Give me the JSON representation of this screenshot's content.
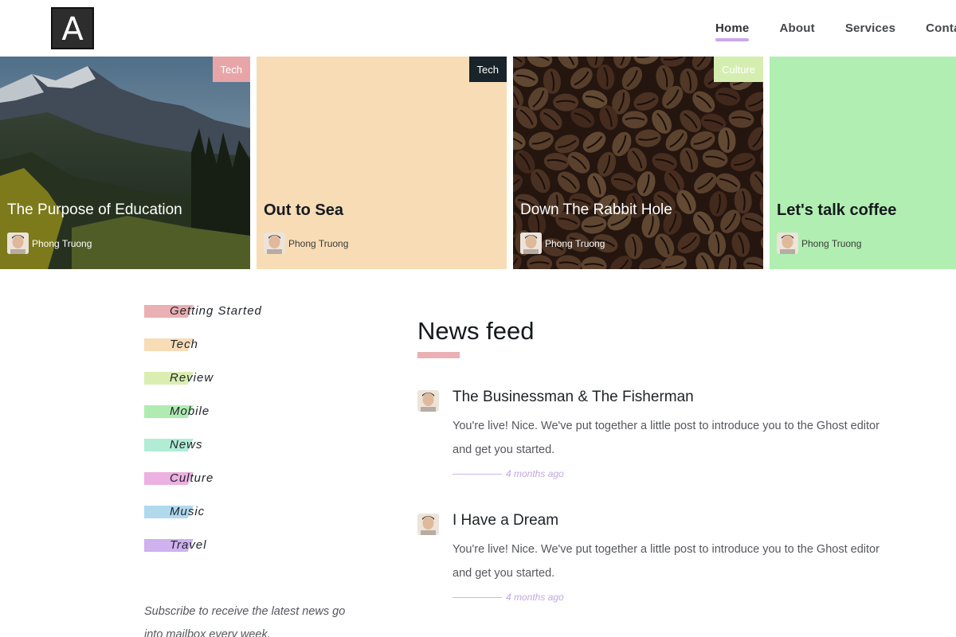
{
  "logo": {
    "letter": "A"
  },
  "nav": [
    {
      "label": "Home",
      "active": true
    },
    {
      "label": "About",
      "active": false
    },
    {
      "label": "Services",
      "active": false
    },
    {
      "label": "Conta",
      "active": false
    }
  ],
  "featured": [
    {
      "title": "The Purpose of Education",
      "tag": "Tech",
      "tag_color": "#e8a5a8",
      "author": "Phong Truong",
      "background": "mountain-photo"
    },
    {
      "title": "Out to Sea",
      "tag": "Tech",
      "tag_color": "#18242a",
      "author": "Phong Truong",
      "background": "#f7dcb5"
    },
    {
      "title": "Down The Rabbit Hole",
      "tag": "Culture",
      "tag_color": "#d4eeb0",
      "author": "Phong Truong",
      "background": "coffee-beans-photo"
    },
    {
      "title": "Let's talk coffee",
      "tag": "",
      "tag_color": "",
      "author": "Phong Truong",
      "background": "#b1eeb1"
    }
  ],
  "categories": [
    {
      "label": "Getting Started",
      "color": "#eab0b3"
    },
    {
      "label": "Tech",
      "color": "#f8dcb6"
    },
    {
      "label": "Review",
      "color": "#dbeeb1"
    },
    {
      "label": "Mobile",
      "color": "#b0ecb1"
    },
    {
      "label": "News",
      "color": "#b1ecd5"
    },
    {
      "label": "Culture",
      "color": "#ecb1e0"
    },
    {
      "label": "Music",
      "color": "#b1d9ee"
    },
    {
      "label": "Travel",
      "color": "#cfb1ee"
    }
  ],
  "subscribe": {
    "text": "Subscribe to receive the latest news go into mailbox every week."
  },
  "newsfeed": {
    "title": "News feed",
    "posts": [
      {
        "title": "The Businessman & The Fisherman",
        "excerpt": "You're live! Nice. We've put together a little post to introduce you to the Ghost editor and get you started.",
        "date": "4 months ago"
      },
      {
        "title": "I Have a Dream",
        "excerpt": "You're live! Nice. We've put together a little post to introduce you to the Ghost editor and get you started.",
        "date": "4 months ago"
      }
    ]
  }
}
